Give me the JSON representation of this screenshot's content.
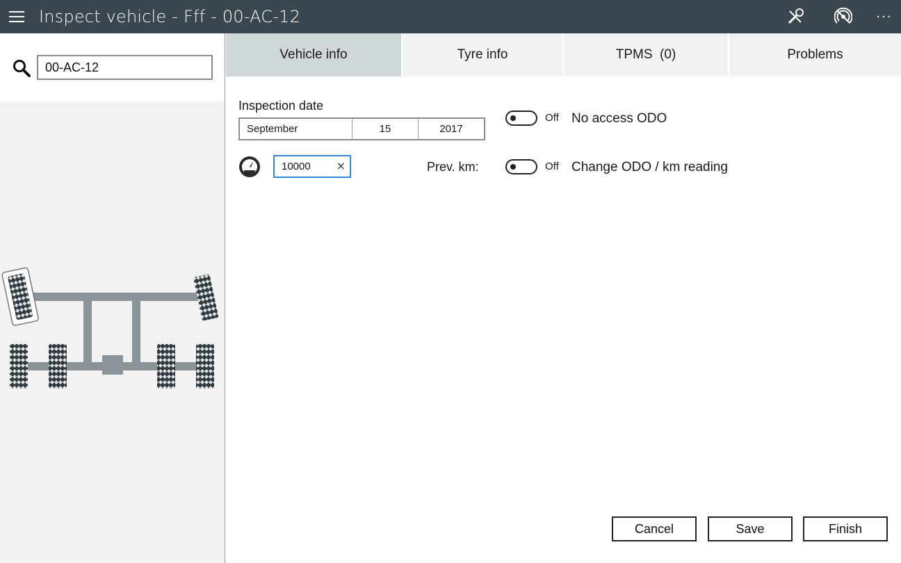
{
  "header": {
    "title": "Inspect vehicle - Fff - 00-AC-12",
    "menu_icon": "hamburger-icon",
    "actions": [
      "connect-tool-icon",
      "sensor-signal-icon",
      "more-icon"
    ],
    "more_label": "···"
  },
  "sidebar": {
    "search": {
      "value": "00-AC-12",
      "icon": "search-icon"
    },
    "diagram": {
      "icon": "vehicle-axle-diagram"
    }
  },
  "tabs": [
    {
      "label": "Vehicle info",
      "active": true
    },
    {
      "label": "Tyre info",
      "active": false
    },
    {
      "label": "TPMS  (0)",
      "active": false
    },
    {
      "label": "Problems",
      "active": false
    }
  ],
  "vehicle_info": {
    "inspection_date_label": "Inspection date",
    "date": {
      "month": "September",
      "day": "15",
      "year": "2017"
    },
    "odometer": {
      "value": "10000",
      "icon": "gauge-icon",
      "clear_label": "×"
    },
    "prev_km_label": "Prev. km:",
    "toggles": [
      {
        "state": "Off",
        "label": "No access ODO",
        "on": false
      },
      {
        "state": "Off",
        "label": "Change ODO / km reading",
        "on": false
      }
    ]
  },
  "footer": {
    "cancel_label": "Cancel",
    "save_label": "Save",
    "finish_label": "Finish"
  },
  "colors": {
    "titlebar": "#3a474e",
    "active_tab": "#d0d7da",
    "inactive_tab": "#f2f2f2",
    "focus_border": "#2e86de",
    "axle": "#8a9397",
    "tyre": "#2f3a40"
  }
}
